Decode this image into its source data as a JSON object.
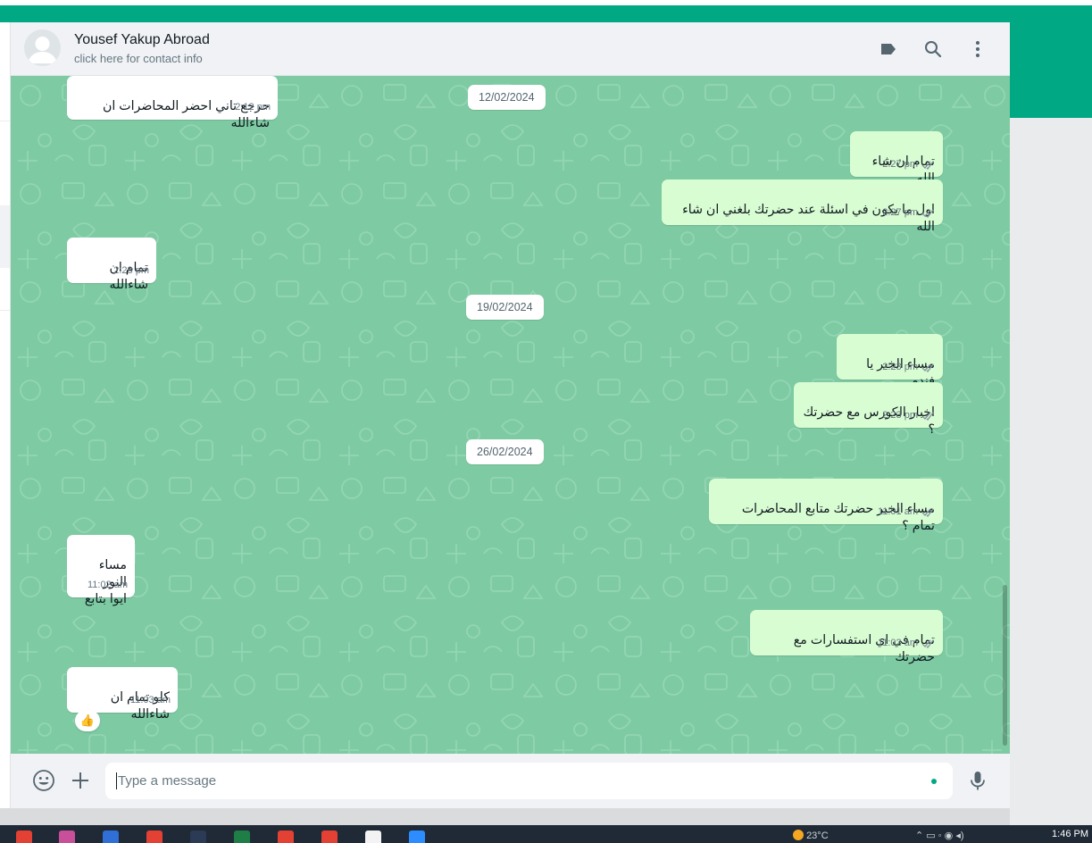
{
  "header": {
    "contact_name": "Yousef Yakup Abroad",
    "contact_subtitle": "click here for contact info",
    "icons": [
      "label-icon",
      "search-icon",
      "menu-icon"
    ]
  },
  "dates": [
    "12/02/2024",
    "19/02/2024",
    "26/02/2024"
  ],
  "messages": [
    {
      "direction": "incoming",
      "text": "حرجع تاني احضر المحاضرات ان شاءالله",
      "time": "2:12 pm"
    },
    {
      "direction": "outgoing",
      "text": "تمام ان شاء الله",
      "time": "2:27 pm",
      "status": "read"
    },
    {
      "direction": "outgoing",
      "text": "اول ما يكون في اسئلة عند حضرتك بلغني ان شاء الله",
      "time": "2:27 pm",
      "status": "read"
    },
    {
      "direction": "incoming",
      "text": "تمام ان شاءالله",
      "time": "2:28 pm"
    },
    {
      "direction": "outgoing",
      "text": "مساء الخير يا فندم",
      "time": "2:23 pm",
      "status": "read"
    },
    {
      "direction": "outgoing",
      "text": "اخبار الكورس مع حضرتك ؟",
      "time": "2:23 pm",
      "status": "read"
    },
    {
      "direction": "outgoing",
      "text": "مساء الخير حضرتك متابع المحاضرات تمام ؟",
      "time": "11:01 am",
      "status": "read"
    },
    {
      "direction": "incoming",
      "text": "مساء النور\nايوا بتابع",
      "time": "11:02 am"
    },
    {
      "direction": "outgoing",
      "text": "تمام في اي استفسارات مع حضرتك",
      "time": "11:02 am",
      "status": "read"
    },
    {
      "direction": "incoming",
      "text": "كلو تمام ان شاءالله",
      "time": "11:03 am",
      "reaction": "👍"
    }
  ],
  "composer": {
    "placeholder": "Type a message",
    "value": "",
    "icons": [
      "emoji-icon",
      "plus-icon",
      "mic-icon"
    ]
  },
  "taskbar": {
    "temperature": "23°C",
    "clock": "1:46 PM"
  },
  "colors": {
    "brand": "#00a884",
    "chat_background": "#7ecba3",
    "outgoing_bubble": "#d9fdd3",
    "incoming_bubble": "#ffffff",
    "read_ticks": "#53bdeb"
  }
}
